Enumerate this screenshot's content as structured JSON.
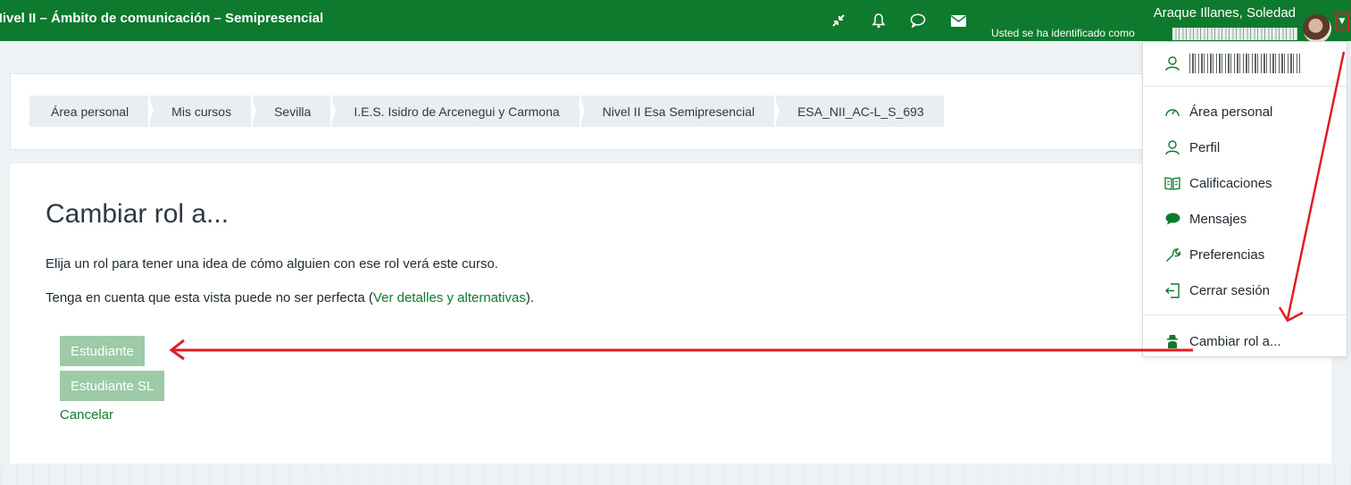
{
  "navbar": {
    "course_title": "Nivel II – Ámbito de comunicación – Semipresencial",
    "user_name": "Araque Illanes, Soledad",
    "login_as_text": "Usted se ha identificado como",
    "icons": [
      "collapse-icon",
      "bell-icon",
      "chat-icon",
      "envelope-icon"
    ],
    "bg_color": "#0e7a2e"
  },
  "breadcrumb": [
    "Área personal",
    "Mis cursos",
    "Sevilla",
    "I.E.S. Isidro de Arcenegui y Carmona",
    "Nivel II Esa Semipresencial",
    "ESA_NII_AC-L_S_693"
  ],
  "main": {
    "title": "Cambiar rol a...",
    "para1": "Elija un rol para tener una idea de cómo alguien con ese rol verá este curso.",
    "para2_before": "Tenga en cuenta que esta vista puede no ser perfecta (",
    "para2_link": "Ver detalles y alternativas",
    "para2_after": ").",
    "roles": [
      "Estudiante",
      "Estudiante SL"
    ],
    "cancel": "Cancelar"
  },
  "dropdown": {
    "items": [
      {
        "label": "Área personal",
        "icon": "dashboard-icon"
      },
      {
        "label": "Perfil",
        "icon": "user-icon"
      },
      {
        "label": "Calificaciones",
        "icon": "book-icon"
      },
      {
        "label": "Mensajes",
        "icon": "chat-bubble-icon"
      },
      {
        "label": "Preferencias",
        "icon": "wrench-icon"
      },
      {
        "label": "Cerrar sesión",
        "icon": "logout-icon"
      }
    ],
    "switch_role": {
      "label": "Cambiar rol a...",
      "icon": "user-secret-icon"
    }
  },
  "colors": {
    "accent": "#0e7a2e",
    "button_bg": "#9dcaa7",
    "annotation": "#e21b23"
  }
}
